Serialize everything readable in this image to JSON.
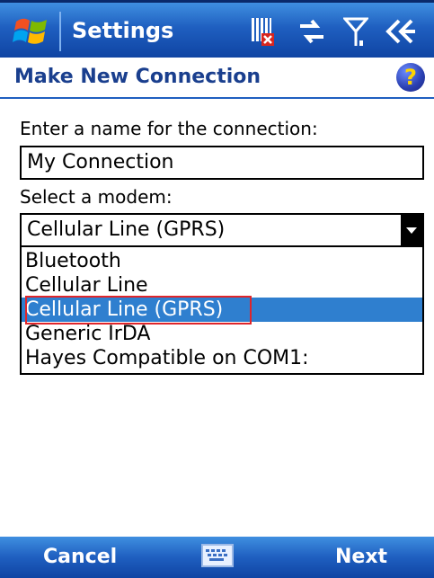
{
  "titlebar": {
    "title": "Settings",
    "icons": [
      "windows-start-icon",
      "memory-card-icon",
      "connectivity-arrows-icon",
      "signal-antenna-icon",
      "speaker-icon"
    ]
  },
  "header": {
    "title": "Make New Connection",
    "help_icon": "help-icon",
    "help_glyph": "?"
  },
  "form": {
    "name_label": "Enter a name for the connection:",
    "name_value": "My Connection",
    "modem_label": "Select a modem:",
    "modem_selected": "Cellular Line (GPRS)",
    "modem_options": [
      "Bluetooth",
      "Cellular Line",
      "Cellular Line (GPRS)",
      "Generic IrDA",
      "Hayes Compatible on COM1:"
    ],
    "selected_index": 2
  },
  "softkeys": {
    "left": "Cancel",
    "right": "Next",
    "center_icon": "keyboard-icon"
  },
  "colors": {
    "bar_blue": "#1f5fc0",
    "header_text": "#1a3f8e",
    "selection": "#2f7fcf",
    "focus_red": "#e0252a"
  }
}
